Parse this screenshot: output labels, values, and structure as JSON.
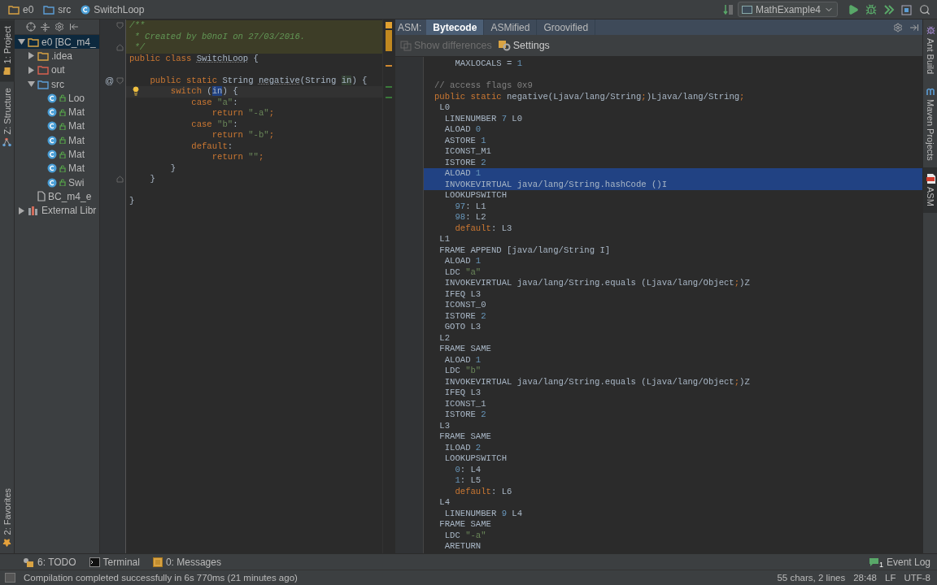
{
  "breadcrumbs": [
    {
      "label": "e0",
      "kind": "module"
    },
    {
      "label": "src",
      "kind": "folder"
    },
    {
      "label": "SwitchLoop",
      "kind": "class"
    }
  ],
  "run_config": {
    "label": "MathExample4"
  },
  "left_tabs": [
    {
      "label": "1: Project",
      "selected": true,
      "kind": "project"
    },
    {
      "label": "Z: Structure",
      "selected": false,
      "kind": "structure"
    }
  ],
  "left_bottom_tabs": [
    {
      "label": "2: Favorites",
      "selected": false,
      "kind": "favorites"
    }
  ],
  "project_tree": [
    {
      "label": "e0 [BC_m4_",
      "kind": "module",
      "expanded": true,
      "selected": true,
      "children": [
        {
          "label": ".idea",
          "kind": "folder",
          "expanded": false,
          "selected": false
        },
        {
          "label": "out",
          "kind": "excluded",
          "expanded": false,
          "selected": false
        },
        {
          "label": "src",
          "kind": "source",
          "expanded": true,
          "selected": false,
          "children": [
            {
              "label": "Loo",
              "kind": "class",
              "selected": false
            },
            {
              "label": "Mat",
              "kind": "class",
              "selected": false
            },
            {
              "label": "Mat",
              "kind": "class",
              "selected": false
            },
            {
              "label": "Mat",
              "kind": "class",
              "selected": false
            },
            {
              "label": "Mat",
              "kind": "class",
              "selected": false
            },
            {
              "label": "Mat",
              "kind": "class",
              "selected": false
            },
            {
              "label": "Swi",
              "kind": "class",
              "selected": false
            }
          ]
        },
        {
          "label": "BC_m4_e",
          "kind": "file",
          "selected": false
        }
      ]
    },
    {
      "label": "External Libr",
      "kind": "library",
      "expanded": false,
      "selected": false
    }
  ],
  "editor": {
    "lines": [
      {
        "segs": [
          {
            "text": "/**",
            "kind": "doc"
          }
        ],
        "doc_block": true,
        "fold_start": true
      },
      {
        "segs": [
          {
            "text": " * Created by b0noI on 27/03/2016.",
            "kind": "doc"
          }
        ],
        "doc_block": true
      },
      {
        "segs": [
          {
            "text": " */",
            "kind": "doc"
          }
        ],
        "doc_block": true,
        "fold_end": true
      },
      {
        "segs": [
          {
            "text": "public class ",
            "kind": "kw"
          },
          {
            "text": "SwitchLoop",
            "kind": "unused"
          },
          {
            "text": " {",
            "kind": "id"
          }
        ]
      },
      {
        "segs": [
          {
            "text": "    public static ",
            "kind": "kw"
          },
          {
            "text": "String ",
            "kind": "id"
          },
          {
            "text": "negative",
            "kind": "unused"
          },
          {
            "text": "(String ",
            "kind": "id"
          },
          {
            "text": "in",
            "kind": "param"
          },
          {
            "text": ") {",
            "kind": "id"
          }
        ],
        "space_before": true,
        "gutter_mark": "@",
        "fold_start": true
      },
      {
        "segs": [
          {
            "text": "        switch ",
            "kind": "kw"
          },
          {
            "text": "(",
            "kind": "id"
          },
          {
            "text": "in",
            "kind": "usage"
          },
          {
            "text": ") {",
            "kind": "id"
          }
        ],
        "caret": true,
        "bulb": true
      },
      {
        "segs": [
          {
            "text": "            case ",
            "kind": "kw"
          },
          {
            "text": "\"a\"",
            "kind": "str"
          },
          {
            "text": ":",
            "kind": "id"
          }
        ]
      },
      {
        "segs": [
          {
            "text": "                return ",
            "kind": "kw"
          },
          {
            "text": "\"-a\"",
            "kind": "str"
          },
          {
            "text": ";",
            "kind": "kw"
          }
        ]
      },
      {
        "segs": [
          {
            "text": "            case ",
            "kind": "kw"
          },
          {
            "text": "\"b\"",
            "kind": "str"
          },
          {
            "text": ":",
            "kind": "id"
          }
        ]
      },
      {
        "segs": [
          {
            "text": "                return ",
            "kind": "kw"
          },
          {
            "text": "\"-b\"",
            "kind": "str"
          },
          {
            "text": ";",
            "kind": "kw"
          }
        ]
      },
      {
        "segs": [
          {
            "text": "            default",
            "kind": "kw"
          },
          {
            "text": ":",
            "kind": "id"
          }
        ]
      },
      {
        "segs": [
          {
            "text": "                return ",
            "kind": "kw"
          },
          {
            "text": "\"\"",
            "kind": "str"
          },
          {
            "text": ";",
            "kind": "kw"
          }
        ]
      },
      {
        "segs": [
          {
            "text": "        }",
            "kind": "id"
          }
        ]
      },
      {
        "segs": [
          {
            "text": "    }",
            "kind": "id"
          }
        ],
        "fold_end": true
      },
      {
        "segs": [
          {
            "text": "}",
            "kind": "id"
          }
        ],
        "space_before": true
      }
    ]
  },
  "asm": {
    "label": "ASM:",
    "tabs": [
      {
        "label": "Bytecode",
        "selected": true
      },
      {
        "label": "ASMified",
        "selected": false
      },
      {
        "label": "Groovified",
        "selected": false
      }
    ],
    "tools": [
      {
        "label": "Show differences",
        "disabled": true,
        "kind": "diff"
      },
      {
        "label": "Settings",
        "disabled": false,
        "kind": "settings"
      }
    ],
    "lines": [
      {
        "segs": [
          {
            "text": "    MAXLOCALS = ",
            "kind": "id"
          },
          {
            "text": "1",
            "kind": "num"
          }
        ]
      },
      {
        "segs": [
          {
            "text": "// access flags 0x9",
            "kind": "cmt"
          }
        ],
        "space_before": true
      },
      {
        "segs": [
          {
            "text": "public static ",
            "kind": "kw"
          },
          {
            "text": "negative(Ljava/lang/String",
            "kind": "id"
          },
          {
            "text": ";",
            "kind": "kw"
          },
          {
            "text": ")Ljava/lang/String",
            "kind": "id"
          },
          {
            "text": ";",
            "kind": "kw"
          }
        ]
      },
      {
        "segs": [
          {
            "text": " L0",
            "kind": "id"
          }
        ]
      },
      {
        "segs": [
          {
            "text": "  LINENUMBER ",
            "kind": "id"
          },
          {
            "text": "7",
            "kind": "num"
          },
          {
            "text": " L0",
            "kind": "id"
          }
        ]
      },
      {
        "segs": [
          {
            "text": "  ALOAD ",
            "kind": "id"
          },
          {
            "text": "0",
            "kind": "num"
          }
        ]
      },
      {
        "segs": [
          {
            "text": "  ASTORE ",
            "kind": "id"
          },
          {
            "text": "1",
            "kind": "num"
          }
        ]
      },
      {
        "segs": [
          {
            "text": "  ICONST_M1",
            "kind": "id"
          }
        ]
      },
      {
        "segs": [
          {
            "text": "  ISTORE ",
            "kind": "id"
          },
          {
            "text": "2",
            "kind": "num"
          }
        ]
      },
      {
        "segs": [
          {
            "text": "  ALOAD ",
            "kind": "id"
          },
          {
            "text": "1",
            "kind": "num"
          }
        ],
        "selected": true
      },
      {
        "segs": [
          {
            "text": "  INVOKEVIRTUAL java/lang/String.hashCode ()I",
            "kind": "id"
          }
        ],
        "selected": true
      },
      {
        "segs": [
          {
            "text": "  LOOKUPSWITCH",
            "kind": "id"
          }
        ]
      },
      {
        "segs": [
          {
            "text": "    97",
            "kind": "num"
          },
          {
            "text": ": L1",
            "kind": "id"
          }
        ]
      },
      {
        "segs": [
          {
            "text": "    98",
            "kind": "num"
          },
          {
            "text": ": L2",
            "kind": "id"
          }
        ]
      },
      {
        "segs": [
          {
            "text": "    default",
            "kind": "kw"
          },
          {
            "text": ": L3",
            "kind": "id"
          }
        ]
      },
      {
        "segs": [
          {
            "text": " L1",
            "kind": "id"
          }
        ]
      },
      {
        "segs": [
          {
            "text": " FRAME APPEND [java/lang/String I]",
            "kind": "id"
          }
        ]
      },
      {
        "segs": [
          {
            "text": "  ALOAD ",
            "kind": "id"
          },
          {
            "text": "1",
            "kind": "num"
          }
        ]
      },
      {
        "segs": [
          {
            "text": "  LDC ",
            "kind": "id"
          },
          {
            "text": "\"a\"",
            "kind": "str"
          }
        ]
      },
      {
        "segs": [
          {
            "text": "  INVOKEVIRTUAL java/lang/String.equals (Ljava/lang/Object",
            "kind": "id"
          },
          {
            "text": ";",
            "kind": "kw"
          },
          {
            "text": ")Z",
            "kind": "id"
          }
        ]
      },
      {
        "segs": [
          {
            "text": "  IFEQ L3",
            "kind": "id"
          }
        ]
      },
      {
        "segs": [
          {
            "text": "  ICONST_0",
            "kind": "id"
          }
        ]
      },
      {
        "segs": [
          {
            "text": "  ISTORE ",
            "kind": "id"
          },
          {
            "text": "2",
            "kind": "num"
          }
        ]
      },
      {
        "segs": [
          {
            "text": "  GOTO L3",
            "kind": "id"
          }
        ]
      },
      {
        "segs": [
          {
            "text": " L2",
            "kind": "id"
          }
        ]
      },
      {
        "segs": [
          {
            "text": " FRAME SAME",
            "kind": "id"
          }
        ]
      },
      {
        "segs": [
          {
            "text": "  ALOAD ",
            "kind": "id"
          },
          {
            "text": "1",
            "kind": "num"
          }
        ]
      },
      {
        "segs": [
          {
            "text": "  LDC ",
            "kind": "id"
          },
          {
            "text": "\"b\"",
            "kind": "str"
          }
        ]
      },
      {
        "segs": [
          {
            "text": "  INVOKEVIRTUAL java/lang/String.equals (Ljava/lang/Object",
            "kind": "id"
          },
          {
            "text": ";",
            "kind": "kw"
          },
          {
            "text": ")Z",
            "kind": "id"
          }
        ]
      },
      {
        "segs": [
          {
            "text": "  IFEQ L3",
            "kind": "id"
          }
        ]
      },
      {
        "segs": [
          {
            "text": "  ICONST_1",
            "kind": "id"
          }
        ]
      },
      {
        "segs": [
          {
            "text": "  ISTORE ",
            "kind": "id"
          },
          {
            "text": "2",
            "kind": "num"
          }
        ]
      },
      {
        "segs": [
          {
            "text": " L3",
            "kind": "id"
          }
        ]
      },
      {
        "segs": [
          {
            "text": " FRAME SAME",
            "kind": "id"
          }
        ]
      },
      {
        "segs": [
          {
            "text": "  ILOAD ",
            "kind": "id"
          },
          {
            "text": "2",
            "kind": "num"
          }
        ]
      },
      {
        "segs": [
          {
            "text": "  LOOKUPSWITCH",
            "kind": "id"
          }
        ]
      },
      {
        "segs": [
          {
            "text": "    0",
            "kind": "num"
          },
          {
            "text": ": L4",
            "kind": "id"
          }
        ]
      },
      {
        "segs": [
          {
            "text": "    1",
            "kind": "num"
          },
          {
            "text": ": L5",
            "kind": "id"
          }
        ]
      },
      {
        "segs": [
          {
            "text": "    default",
            "kind": "kw"
          },
          {
            "text": ": L6",
            "kind": "id"
          }
        ]
      },
      {
        "segs": [
          {
            "text": " L4",
            "kind": "id"
          }
        ]
      },
      {
        "segs": [
          {
            "text": "  LINENUMBER ",
            "kind": "id"
          },
          {
            "text": "9",
            "kind": "num"
          },
          {
            "text": " L4",
            "kind": "id"
          }
        ]
      },
      {
        "segs": [
          {
            "text": " FRAME SAME",
            "kind": "id"
          }
        ]
      },
      {
        "segs": [
          {
            "text": "  LDC ",
            "kind": "id"
          },
          {
            "text": "\"-a\"",
            "kind": "str"
          }
        ]
      },
      {
        "segs": [
          {
            "text": "  ARETURN",
            "kind": "id"
          }
        ]
      }
    ]
  },
  "right_tabs": [
    {
      "label": "Ant Build",
      "selected": false,
      "kind": "ant"
    },
    {
      "label": "Maven Projects",
      "selected": false,
      "kind": "maven"
    },
    {
      "label": "ASM",
      "selected": true,
      "kind": "asm"
    }
  ],
  "bottom_tools": [
    {
      "label": "6: TODO",
      "kind": "todo"
    },
    {
      "label": "Terminal",
      "kind": "terminal"
    },
    {
      "label": "0: Messages",
      "kind": "messages"
    }
  ],
  "event_log": {
    "label": "Event Log",
    "count": "1"
  },
  "status_bar": {
    "message": "Compilation completed successfully in 6s 770ms (21 minutes ago)",
    "items": [
      "55 chars, 2 lines",
      "28:48",
      "LF",
      "UTF-8"
    ]
  }
}
